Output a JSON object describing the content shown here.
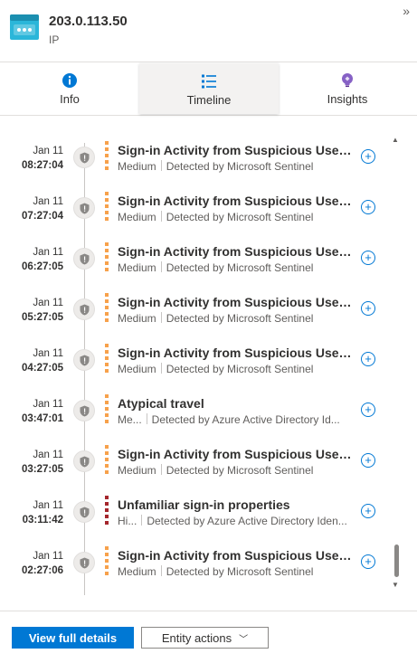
{
  "header": {
    "title": "203.0.113.50",
    "subtitle": "IP",
    "collapse_glyph": "»",
    "entity_icon": "ip-address-icon"
  },
  "tabs": [
    {
      "label": "Info",
      "icon": "info-icon",
      "active": false
    },
    {
      "label": "Timeline",
      "icon": "timeline-list-icon",
      "active": true
    },
    {
      "label": "Insights",
      "icon": "insights-bulb-icon",
      "active": false
    }
  ],
  "timeline": [
    {
      "date": "Jan 11",
      "time": "08:27:04",
      "title": "Sign-in Activity from Suspicious User p...",
      "severity": "Medium",
      "detected_by": "Detected by Microsoft Sentinel",
      "level": "medium"
    },
    {
      "date": "Jan 11",
      "time": "07:27:04",
      "title": "Sign-in Activity from Suspicious User p...",
      "severity": "Medium",
      "detected_by": "Detected by Microsoft Sentinel",
      "level": "medium"
    },
    {
      "date": "Jan 11",
      "time": "06:27:05",
      "title": "Sign-in Activity from Suspicious User p...",
      "severity": "Medium",
      "detected_by": "Detected by Microsoft Sentinel",
      "level": "medium"
    },
    {
      "date": "Jan 11",
      "time": "05:27:05",
      "title": "Sign-in Activity from Suspicious User p...",
      "severity": "Medium",
      "detected_by": "Detected by Microsoft Sentinel",
      "level": "medium"
    },
    {
      "date": "Jan 11",
      "time": "04:27:05",
      "title": "Sign-in Activity from Suspicious User p...",
      "severity": "Medium",
      "detected_by": "Detected by Microsoft Sentinel",
      "level": "medium"
    },
    {
      "date": "Jan 11",
      "time": "03:47:01",
      "title": "Atypical travel",
      "severity": "Me...",
      "detected_by": "Detected by Azure Active Directory Id...",
      "level": "medium"
    },
    {
      "date": "Jan 11",
      "time": "03:27:05",
      "title": "Sign-in Activity from Suspicious User p...",
      "severity": "Medium",
      "detected_by": "Detected by Microsoft Sentinel",
      "level": "medium"
    },
    {
      "date": "Jan 11",
      "time": "03:11:42",
      "title": "Unfamiliar sign-in properties",
      "severity": "Hi...",
      "detected_by": "Detected by Azure Active Directory Iden...",
      "level": "high"
    },
    {
      "date": "Jan 11",
      "time": "02:27:06",
      "title": "Sign-in Activity from Suspicious User p...",
      "severity": "Medium",
      "detected_by": "Detected by Microsoft Sentinel",
      "level": "medium"
    }
  ],
  "footer": {
    "primary_label": "View full details",
    "secondary_label": "Entity actions"
  },
  "colors": {
    "accent": "#0078d4",
    "medium_severity": "#f7a14b",
    "high_severity": "#a4262c",
    "icon_cyan": "#2bb6d9"
  }
}
